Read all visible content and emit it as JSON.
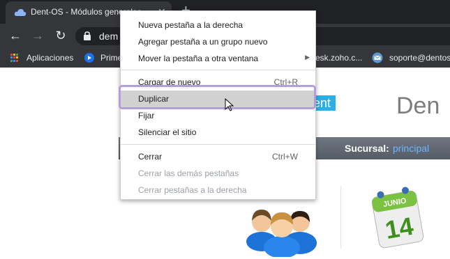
{
  "tab": {
    "title": "Dent-OS - Módulos generales",
    "close": "✕"
  },
  "toolbar": {
    "back": "←",
    "forward": "→",
    "reload": "↻",
    "url": "dem"
  },
  "bookmarks": [
    {
      "label": "Aplicaciones"
    },
    {
      "label": "Prime"
    },
    {
      "label": "esk.zoho.c..."
    },
    {
      "label": "soporte@dentos"
    }
  ],
  "page": {
    "logo_accent": "ent",
    "logo_text": "Den",
    "sucursal_label": "Sucursal:",
    "sucursal_value": "principal",
    "calendar": {
      "month": "JUNIO",
      "day": "14"
    }
  },
  "context_menu": {
    "items": [
      {
        "label": "Nueva pestaña a la derecha",
        "shortcut": "",
        "disabled": false
      },
      {
        "label": "Agregar pestaña a un grupo nuevo",
        "shortcut": "",
        "disabled": false
      },
      {
        "label": "Mover la pestaña a otra ventana",
        "shortcut": "",
        "disabled": false,
        "submenu": true
      },
      {
        "label": "Cargar de nuevo",
        "shortcut": "Ctrl+R",
        "disabled": false
      },
      {
        "label": "Duplicar",
        "shortcut": "",
        "disabled": false,
        "highlighted": true
      },
      {
        "label": "Fijar",
        "shortcut": "",
        "disabled": false
      },
      {
        "label": "Silenciar el sitio",
        "shortcut": "",
        "disabled": false
      },
      {
        "label": "Cerrar",
        "shortcut": "Ctrl+W",
        "disabled": false
      },
      {
        "label": "Cerrar las demás pestañas",
        "shortcut": "",
        "disabled": true
      },
      {
        "label": "Cerrar pestañas a la derecha",
        "shortcut": "",
        "disabled": true
      }
    ]
  },
  "colors": {
    "chrome_dark": "#202124",
    "toolbar": "#35363a",
    "accent_blue": "#2ab0e6",
    "highlight": "#b39ddb"
  }
}
